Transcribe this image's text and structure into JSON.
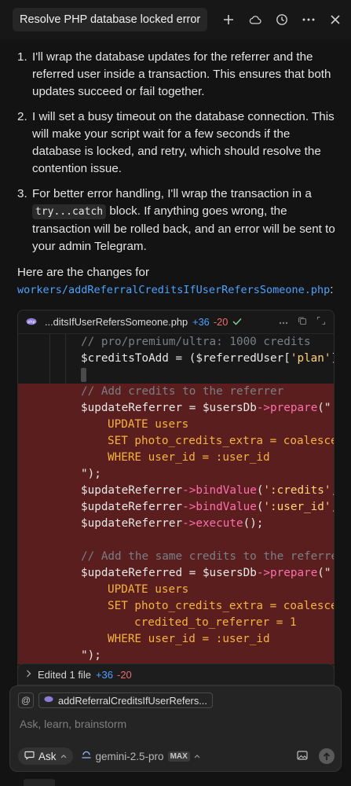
{
  "header": {
    "title": "Resolve PHP database locked error",
    "icons": [
      "plus-icon",
      "cloud-icon",
      "history-icon",
      "more-icon",
      "close-icon"
    ]
  },
  "message": {
    "steps": [
      {
        "num": "1.",
        "text": "I'll wrap the database updates for the referrer and the referred user inside a transaction. This ensures that both updates succeed or fail together."
      },
      {
        "num": "2.",
        "text": "I will set a busy timeout on the database connection. This will make your script wait for a few seconds if the database is locked, and retry, which should resolve the contention issue."
      },
      {
        "num": "3.",
        "text_before": "For better error handling, I'll wrap the transaction in a ",
        "code": "try...catch",
        "text_after": " block. If anything goes wrong, the transaction will be rolled back, and an error will be sent to your admin Telegram."
      }
    ],
    "intro_before": "Here are the changes for ",
    "intro_path": "workers/addReferralCreditsIfUserRefersSomeone.php",
    "intro_after": ":"
  },
  "code_card": {
    "filename": "...ditsIfUserRefersSomeone.php",
    "additions": "+36",
    "removals": "-20",
    "lines": [
      {
        "kind": "ctx",
        "indent": 0,
        "parts": [
          {
            "c": "cm",
            "t": "// pro/premium/ultra: 1000 credits"
          }
        ]
      },
      {
        "kind": "ctx",
        "indent": 0,
        "parts": [
          {
            "c": "var",
            "t": "$creditsToAdd"
          },
          {
            "c": "op",
            "t": " = ("
          },
          {
            "c": "var",
            "t": "$referredUser"
          },
          {
            "c": "op",
            "t": "["
          },
          {
            "c": "str",
            "t": "'plan'"
          },
          {
            "c": "op",
            "t": "] "
          }
        ]
      },
      {
        "kind": "cursor",
        "indent": 0,
        "parts": []
      },
      {
        "kind": "del",
        "indent": 0,
        "parts": [
          {
            "c": "cm",
            "t": "// Add credits to the referrer"
          }
        ]
      },
      {
        "kind": "del",
        "indent": 0,
        "parts": [
          {
            "c": "var",
            "t": "$updateReferrer"
          },
          {
            "c": "op",
            "t": " = "
          },
          {
            "c": "var",
            "t": "$usersDb"
          },
          {
            "c": "fn",
            "t": "->prepare"
          },
          {
            "c": "op",
            "t": "(\""
          }
        ]
      },
      {
        "kind": "del",
        "indent": 1,
        "parts": [
          {
            "c": "kw",
            "t": "UPDATE users"
          }
        ]
      },
      {
        "kind": "del",
        "indent": 1,
        "parts": [
          {
            "c": "kw",
            "t": "SET photo_credits_extra = coalesce"
          }
        ]
      },
      {
        "kind": "del",
        "indent": 1,
        "parts": [
          {
            "c": "kw",
            "t": "WHERE user_id = :user_id"
          }
        ]
      },
      {
        "kind": "del",
        "indent": 0,
        "parts": [
          {
            "c": "op",
            "t": "\");"
          }
        ]
      },
      {
        "kind": "del",
        "indent": 0,
        "parts": [
          {
            "c": "var",
            "t": "$updateReferrer"
          },
          {
            "c": "fn",
            "t": "->bindValue"
          },
          {
            "c": "op",
            "t": "("
          },
          {
            "c": "str",
            "t": "':credits'"
          },
          {
            "c": "op",
            "t": ","
          }
        ]
      },
      {
        "kind": "del",
        "indent": 0,
        "parts": [
          {
            "c": "var",
            "t": "$updateReferrer"
          },
          {
            "c": "fn",
            "t": "->bindValue"
          },
          {
            "c": "op",
            "t": "("
          },
          {
            "c": "str",
            "t": "':user_id'"
          },
          {
            "c": "op",
            "t": ","
          }
        ]
      },
      {
        "kind": "del",
        "indent": 0,
        "parts": [
          {
            "c": "var",
            "t": "$updateReferrer"
          },
          {
            "c": "fn",
            "t": "->execute"
          },
          {
            "c": "op",
            "t": "();"
          }
        ]
      },
      {
        "kind": "del",
        "indent": 0,
        "parts": []
      },
      {
        "kind": "del",
        "indent": 0,
        "parts": [
          {
            "c": "cm",
            "t": "// Add the same credits to the referred"
          }
        ]
      },
      {
        "kind": "del",
        "indent": 0,
        "parts": [
          {
            "c": "var",
            "t": "$updateReferred"
          },
          {
            "c": "op",
            "t": " = "
          },
          {
            "c": "var",
            "t": "$usersDb"
          },
          {
            "c": "fn",
            "t": "->prepare"
          },
          {
            "c": "op",
            "t": "(\""
          }
        ]
      },
      {
        "kind": "del",
        "indent": 1,
        "parts": [
          {
            "c": "kw",
            "t": "UPDATE users"
          }
        ]
      },
      {
        "kind": "del",
        "indent": 1,
        "parts": [
          {
            "c": "kw",
            "t": "SET photo_credits_extra = coalesce"
          }
        ]
      },
      {
        "kind": "del",
        "indent": 2,
        "parts": [
          {
            "c": "kw",
            "t": "credited_to_referrer = 1"
          }
        ]
      },
      {
        "kind": "del",
        "indent": 1,
        "parts": [
          {
            "c": "kw",
            "t": "WHERE user_id = :user_id"
          }
        ]
      },
      {
        "kind": "del",
        "indent": 0,
        "parts": [
          {
            "c": "op",
            "t": "\");"
          }
        ]
      }
    ]
  },
  "edited_bar": {
    "label": "Edited 1 file",
    "additions": "+36",
    "removals": "-20"
  },
  "composer": {
    "at_symbol": "@",
    "context_file": "addReferralCreditsIfUserRefers...",
    "placeholder": "Ask, learn, brainstorm",
    "mode": "Ask",
    "model": "gemini-2.5-pro",
    "model_badge": "MAX"
  },
  "colors": {
    "background": "#131313",
    "deleted_line": "#5a1e1e",
    "link_blue": "#4ea1ff",
    "removed_red": "#f06a6a"
  }
}
